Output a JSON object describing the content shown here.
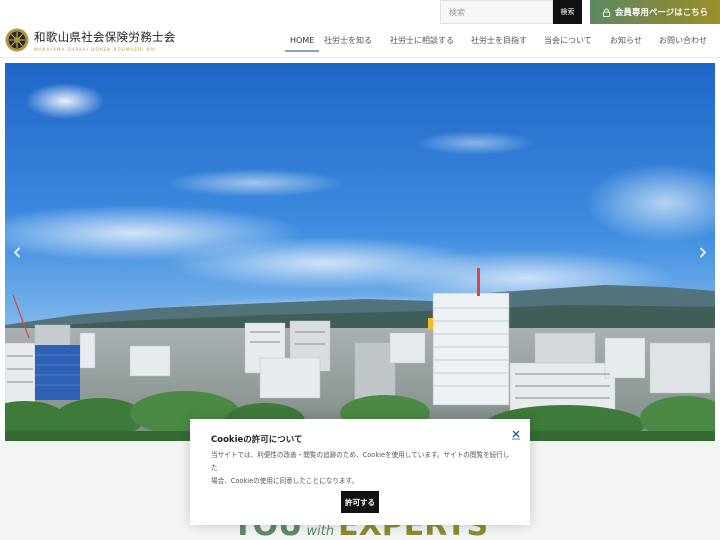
{
  "header": {
    "search": {
      "placeholder": "検索",
      "button_label": "検索"
    },
    "member_button_label": "会員専用ページはこちら",
    "logo": {
      "title": "和歌山県社会保険労務士会",
      "subtitle": "WAKAYAMA SHAKAI HOKEN ROUMUSHI KAI",
      "mark_icon": "emblem-icon"
    }
  },
  "nav": {
    "items": [
      {
        "label": "HOME",
        "active": true
      },
      {
        "label": "社労士を知る"
      },
      {
        "label": "社労士に相談する"
      },
      {
        "label": "社労士を目指す"
      },
      {
        "label": "当会について"
      },
      {
        "label": "お知らせ"
      },
      {
        "label": "お問い合わせ"
      }
    ]
  },
  "hero": {
    "prev_icon": "chevron-left-icon",
    "next_icon": "chevron-right-icon"
  },
  "tagline": {
    "you": "YOU",
    "with": "with",
    "experts": "EXPERTS"
  },
  "cookie": {
    "title": "Cookieの許可について",
    "body_line1": "当サイトでは、利便性の改善・閲覧の追跡のため、Cookieを使用しています。サイトの閲覧を続行した",
    "body_line2": "場合、Cookieの使用に同意したことになります。",
    "accept_label": "許可する",
    "close_icon": "close-icon"
  },
  "colors": {
    "accent_green": "#5e8a66",
    "accent_gold": "#9b8f2a",
    "nav_underline": "#87a9b5",
    "button_dark": "#111111"
  }
}
